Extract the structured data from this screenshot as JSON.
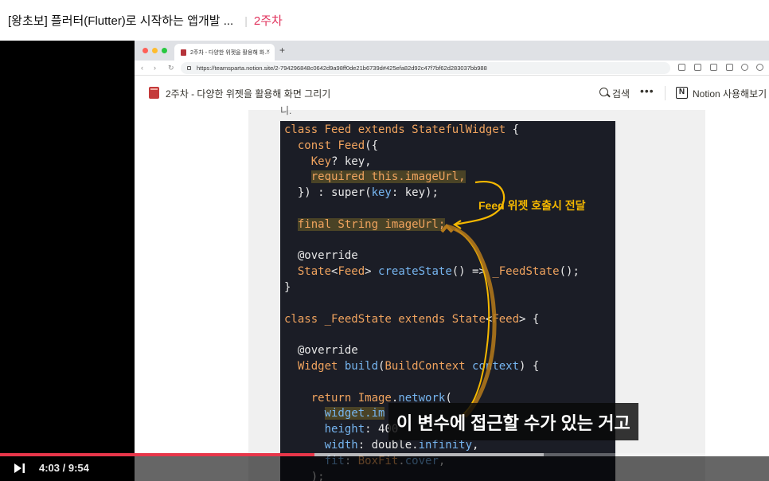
{
  "header": {
    "course_title": "[왕초보] 플러터(Flutter)로 시작하는 앱개발 ...",
    "separator": "|",
    "chapter": "2주차"
  },
  "browser": {
    "tab_title": "2주차 - 다양한 위젯을 활용해 화...",
    "tab_close": "×",
    "new_tab": "+",
    "url": "https://teamsparta.notion.site/2-794296848c0642d9a98ff0de21b6739d#425efa82d92c47f7bf62d283037bb988",
    "nav_back": "‹",
    "nav_forward": "›",
    "nav_reload": "↻"
  },
  "notion": {
    "page_title": "2주차 - 다양한 위젯을 활용해 화면 그리기",
    "search_label": "검색",
    "more_label": "•••",
    "logo_letter": "N",
    "open_label": "Notion 사용해보기"
  },
  "content": {
    "snippet_text": "니.",
    "annotation": "Feed 위젯 호출시 전달"
  },
  "code_lines": [
    [
      {
        "t": "class ",
        "c": "kw"
      },
      {
        "t": "Feed ",
        "c": "ty"
      },
      {
        "t": "extends ",
        "c": "kw"
      },
      {
        "t": "StatefulWidget",
        "c": "ty"
      },
      {
        "t": " {",
        "c": "pl"
      }
    ],
    [
      {
        "t": "  const ",
        "c": "kw"
      },
      {
        "t": "Feed",
        "c": "ty"
      },
      {
        "t": "({",
        "c": "pl"
      }
    ],
    [
      {
        "t": "    Key",
        "c": "ty"
      },
      {
        "t": "? key,",
        "c": "pl"
      }
    ],
    [
      {
        "t": "    ",
        "c": "pl"
      },
      {
        "t": "required this.imageUrl,",
        "c": "kw hl"
      }
    ],
    [
      {
        "t": "  }) : super(",
        "c": "pl"
      },
      {
        "t": "key",
        "c": "fn"
      },
      {
        "t": ": key);",
        "c": "pl"
      }
    ],
    [
      {
        "t": "",
        "c": "pl"
      }
    ],
    [
      {
        "t": "  ",
        "c": "pl"
      },
      {
        "t": "final String imageUrl;",
        "c": "kw hl"
      }
    ],
    [
      {
        "t": "",
        "c": "pl"
      }
    ],
    [
      {
        "t": "  @override",
        "c": "pl"
      }
    ],
    [
      {
        "t": "  State",
        "c": "ty"
      },
      {
        "t": "<",
        "c": "pl"
      },
      {
        "t": "Feed",
        "c": "ty"
      },
      {
        "t": "> ",
        "c": "pl"
      },
      {
        "t": "createState",
        "c": "fn"
      },
      {
        "t": "() => ",
        "c": "pl"
      },
      {
        "t": "_FeedState",
        "c": "ty"
      },
      {
        "t": "();",
        "c": "pl"
      }
    ],
    [
      {
        "t": "}",
        "c": "pl"
      }
    ],
    [
      {
        "t": "",
        "c": "pl"
      }
    ],
    [
      {
        "t": "class ",
        "c": "kw"
      },
      {
        "t": "_FeedState ",
        "c": "ty"
      },
      {
        "t": "extends ",
        "c": "kw"
      },
      {
        "t": "State",
        "c": "ty"
      },
      {
        "t": "<",
        "c": "pl"
      },
      {
        "t": "Feed",
        "c": "ty"
      },
      {
        "t": "> {",
        "c": "pl"
      }
    ],
    [
      {
        "t": "",
        "c": "pl"
      }
    ],
    [
      {
        "t": "  @override",
        "c": "pl"
      }
    ],
    [
      {
        "t": "  Widget ",
        "c": "ty"
      },
      {
        "t": "build",
        "c": "fn"
      },
      {
        "t": "(",
        "c": "pl"
      },
      {
        "t": "BuildContext ",
        "c": "ty"
      },
      {
        "t": "context",
        "c": "fn"
      },
      {
        "t": ") {",
        "c": "pl"
      }
    ],
    [
      {
        "t": "",
        "c": "pl"
      }
    ],
    [
      {
        "t": "    return ",
        "c": "kw"
      },
      {
        "t": "Image",
        "c": "ty"
      },
      {
        "t": ".",
        "c": "pl"
      },
      {
        "t": "network",
        "c": "fn"
      },
      {
        "t": "(",
        "c": "pl"
      }
    ],
    [
      {
        "t": "      ",
        "c": "pl"
      },
      {
        "t": "widget.im",
        "c": "fn hl"
      }
    ],
    [
      {
        "t": "      height",
        "c": "fn"
      },
      {
        "t": ": 400",
        "c": "pl"
      }
    ],
    [
      {
        "t": "      width",
        "c": "fn"
      },
      {
        "t": ": double.",
        "c": "pl"
      },
      {
        "t": "infinity",
        "c": "fn"
      },
      {
        "t": ",",
        "c": "pl"
      }
    ],
    [
      {
        "t": "      fit",
        "c": "fn"
      },
      {
        "t": ": ",
        "c": "pl"
      },
      {
        "t": "BoxFit",
        "c": "ty"
      },
      {
        "t": ".",
        "c": "pl"
      },
      {
        "t": "cover",
        "c": "fn"
      },
      {
        "t": ",",
        "c": "pl"
      }
    ],
    [
      {
        "t": "    );",
        "c": "pl"
      }
    ]
  ],
  "subtitle": "이 변수에 접근할 수가 있는 거고",
  "player": {
    "current_time": "4:03",
    "time_separator": " / ",
    "duration": "9:54",
    "progress_fraction": 0.409,
    "buffered_fraction": 0.707,
    "progress_color": "#e8364a"
  },
  "colors": {
    "chapter_accent": "#e0315b",
    "annotation": "#f5b800",
    "code_bg": "#1b1d26"
  },
  "icons": {
    "next": "next-track-icon",
    "search": "search-icon",
    "more": "more-icon",
    "notion": "notion-logo-icon",
    "book": "book-icon"
  }
}
